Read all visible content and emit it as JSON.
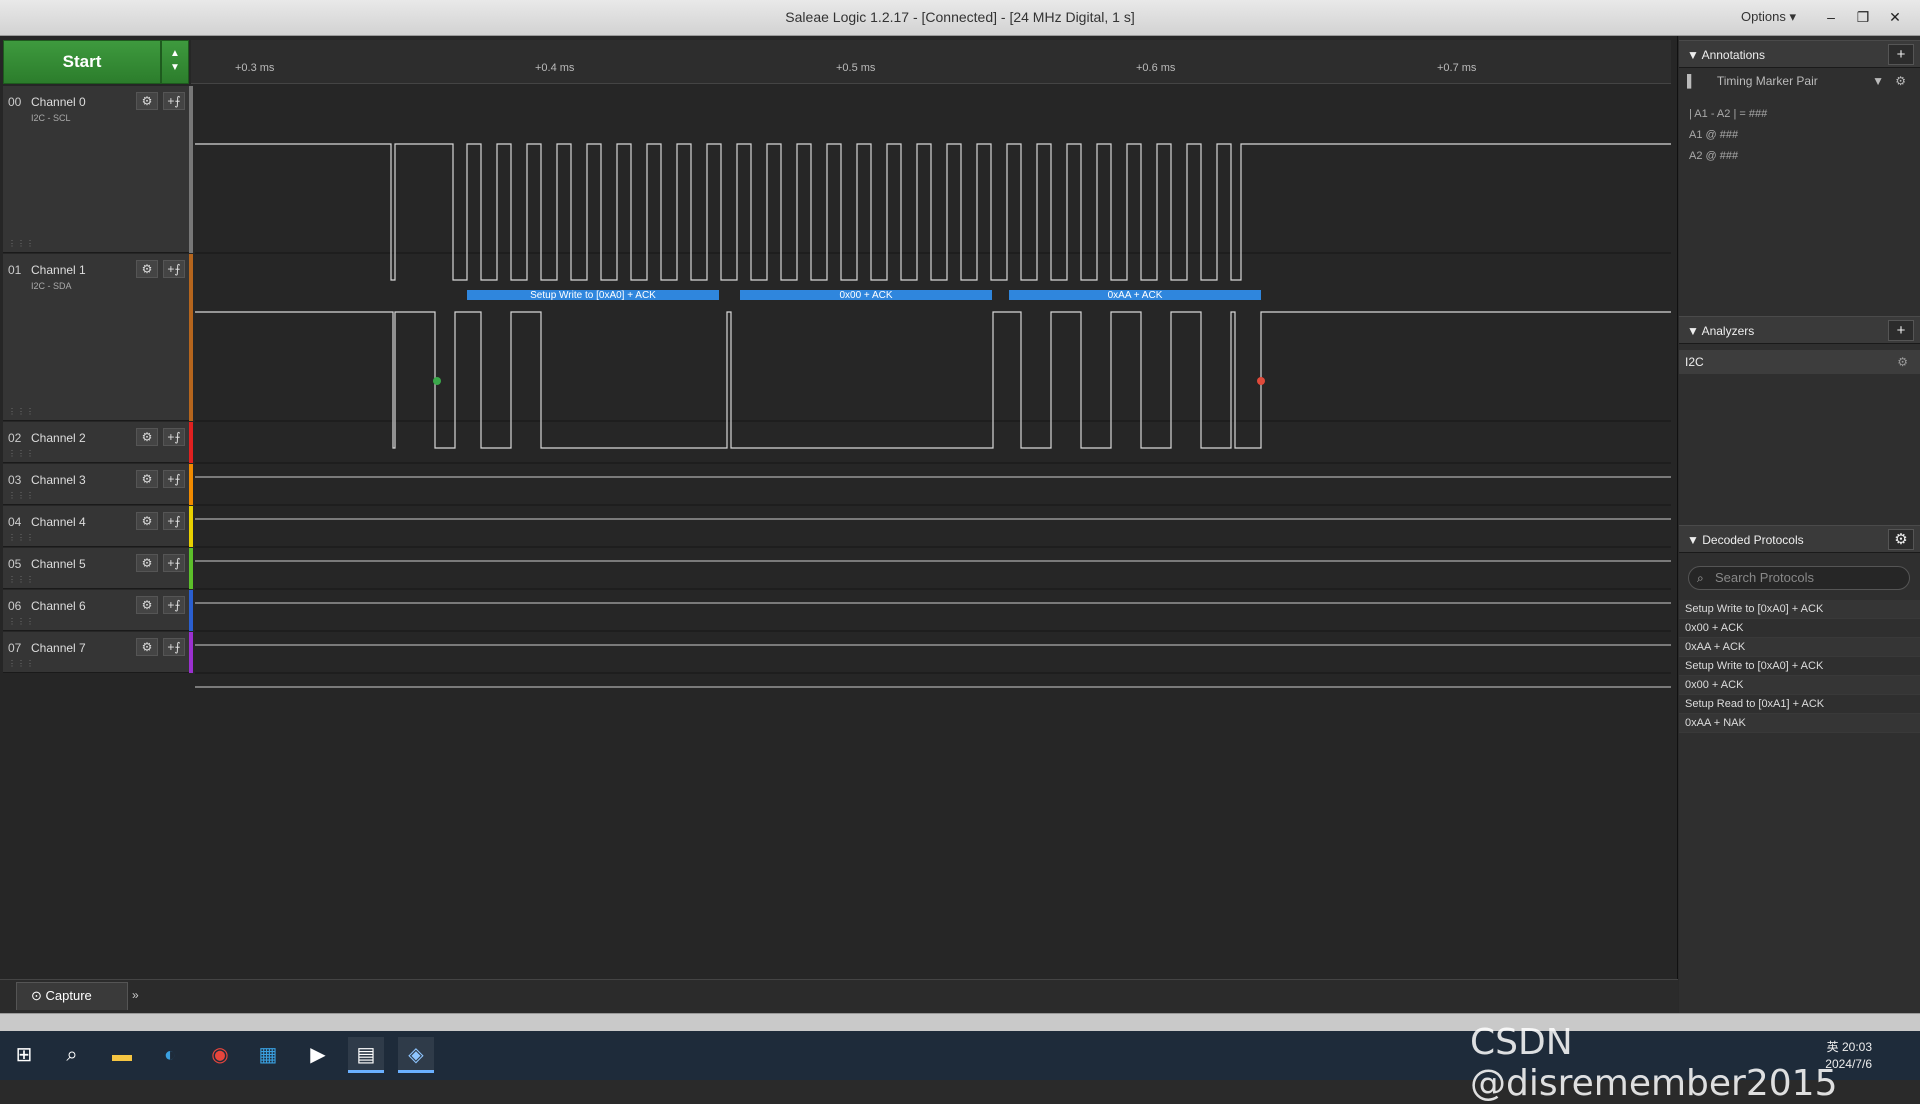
{
  "window": {
    "title": "Saleae Logic 1.2.17 - [Connected] - [24 MHz Digital, 1 s]",
    "options_label": "Options",
    "options_icon": "chevron-down-icon",
    "minimize_icon": "minimize-icon",
    "restore_icon": "restore-icon",
    "close_icon": "close-icon"
  },
  "toolbar": {
    "start_label": "Start"
  },
  "time_ruler": [
    "+0.3 ms",
    "+0.4 ms",
    "+0.5 ms",
    "+0.6 ms",
    "+0.7 ms"
  ],
  "channels": [
    {
      "num": "00",
      "name": "Channel 0",
      "sub": "I2C - SCL",
      "color": "#777777"
    },
    {
      "num": "01",
      "name": "Channel 1",
      "sub": "I2C - SDA",
      "color": "#b5651d"
    },
    {
      "num": "02",
      "name": "Channel 2",
      "sub": "",
      "color": "#e02020"
    },
    {
      "num": "03",
      "name": "Channel 3",
      "sub": "",
      "color": "#f08a00"
    },
    {
      "num": "04",
      "name": "Channel 4",
      "sub": "",
      "color": "#e8d000"
    },
    {
      "num": "05",
      "name": "Channel 5",
      "sub": "",
      "color": "#5cbf2a"
    },
    {
      "num": "06",
      "name": "Channel 6",
      "sub": "",
      "color": "#2a5fd0"
    },
    {
      "num": "07",
      "name": "Channel 7",
      "sub": "",
      "color": "#9b30d0"
    }
  ],
  "decode_bubbles": [
    "Setup Write to [0xA0] + ACK",
    "0x00 + ACK",
    "0xAA + ACK"
  ],
  "bottom_tab": {
    "capture_label": "Capture",
    "more_icon": "double-chevron-right-icon"
  },
  "annotations": {
    "title": "Annotations",
    "add_icon": "plus-icon",
    "timing_marker": "Timing Marker Pair",
    "measure_line": "| A1 - A2 | = ###",
    "a1_line": "A1 @ ###",
    "a2_line": "A2 @ ###"
  },
  "analyzers": {
    "title": "Analyzers",
    "items": [
      "I2C"
    ]
  },
  "decoded_protocols": {
    "title": "Decoded Protocols",
    "search_placeholder": "Search Protocols",
    "items": [
      "Setup Write to [0xA0] + ACK",
      "0x00 + ACK",
      "0xAA + ACK",
      "Setup Write to [0xA0] + ACK",
      "0x00 + ACK",
      "Setup Read to [0xA1] + ACK",
      "0xAA + NAK"
    ]
  },
  "taskbar": {
    "time": "20:03",
    "date": "2024/7/6",
    "ime": "英"
  },
  "watermark": "CSDN @disremember2015"
}
